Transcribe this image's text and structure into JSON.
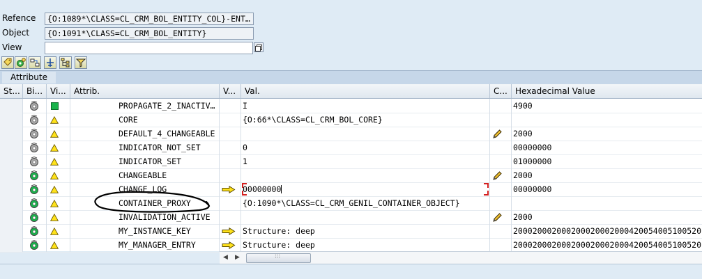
{
  "header": {
    "reference_label": "Refence",
    "reference_value": "{O:1089*\\CLASS=CL_CRM_BOL_ENTITY_COL}-ENT…",
    "object_label": "Object",
    "object_value": "{O:1091*\\CLASS=CL_CRM_BOL_ENTITY}",
    "view_label": "View",
    "view_value": ""
  },
  "toolbar": {
    "icons": [
      "tag-icon",
      "settings-gear-icon",
      "flow-icon",
      "pin-icon",
      "hierarchy-icon",
      "filter-icon"
    ]
  },
  "tabs": {
    "attribute": "Attribute"
  },
  "grid": {
    "columns": [
      "St...",
      "Bi...",
      "Vi...",
      "Attrib.",
      "V...",
      "Val.",
      "C...",
      "Hexadecimal Value"
    ],
    "rows": [
      {
        "bind": "gray",
        "vis": "green-square",
        "attr": "PROPAGATE_2_INACTIV…",
        "arrow": false,
        "val": "I",
        "edit": false,
        "hex": "4900",
        "editing": false
      },
      {
        "bind": "gray",
        "vis": "yellow-triangle",
        "attr": "CORE",
        "arrow": false,
        "val": "{O:66*\\CLASS=CL_CRM_BOL_CORE}",
        "edit": false,
        "hex": "",
        "editing": false
      },
      {
        "bind": "gray",
        "vis": "yellow-triangle",
        "attr": "DEFAULT_4_CHANGEABLE",
        "arrow": false,
        "val": "",
        "edit": true,
        "hex": "2000",
        "editing": false
      },
      {
        "bind": "gray",
        "vis": "yellow-triangle",
        "attr": "INDICATOR_NOT_SET",
        "arrow": false,
        "val": "0",
        "edit": false,
        "hex": "00000000",
        "editing": false
      },
      {
        "bind": "gray",
        "vis": "yellow-triangle",
        "attr": "INDICATOR_SET",
        "arrow": false,
        "val": "1",
        "edit": false,
        "hex": "01000000",
        "editing": false
      },
      {
        "bind": "green",
        "vis": "yellow-triangle",
        "attr": "CHANGEABLE",
        "arrow": false,
        "val": "",
        "edit": true,
        "hex": "2000",
        "editing": false
      },
      {
        "bind": "green",
        "vis": "yellow-triangle",
        "attr": "CHANGE_LOG",
        "arrow": true,
        "val": "00000000",
        "edit": false,
        "hex": "00000000",
        "editing": true
      },
      {
        "bind": "green",
        "vis": "yellow-triangle",
        "attr": "CONTAINER_PROXY",
        "arrow": false,
        "val": "{O:1090*\\CLASS=CL_CRM_GENIL_CONTAINER_OBJECT}",
        "edit": false,
        "hex": "",
        "editing": false
      },
      {
        "bind": "green",
        "vis": "yellow-triangle",
        "attr": "INVALIDATION_ACTIVE",
        "arrow": false,
        "val": "",
        "edit": true,
        "hex": "2000",
        "editing": false
      },
      {
        "bind": "green",
        "vis": "yellow-triangle",
        "attr": "MY_INSTANCE_KEY",
        "arrow": true,
        "val": "Structure: deep",
        "edit": false,
        "hex": "200020002000200020002000420054005100520",
        "editing": false
      },
      {
        "bind": "green",
        "vis": "yellow-triangle",
        "attr": "MY_MANAGER_ENTRY",
        "arrow": true,
        "val": "Structure: deep",
        "edit": false,
        "hex": "200020002000200020002000420054005100520",
        "editing": false
      }
    ]
  },
  "scrollbar": {
    "grip": ":::"
  },
  "colors": {
    "accent_green": "#19b34b",
    "warning_yellow": "#ffe21a",
    "edit_red": "#d42020"
  }
}
